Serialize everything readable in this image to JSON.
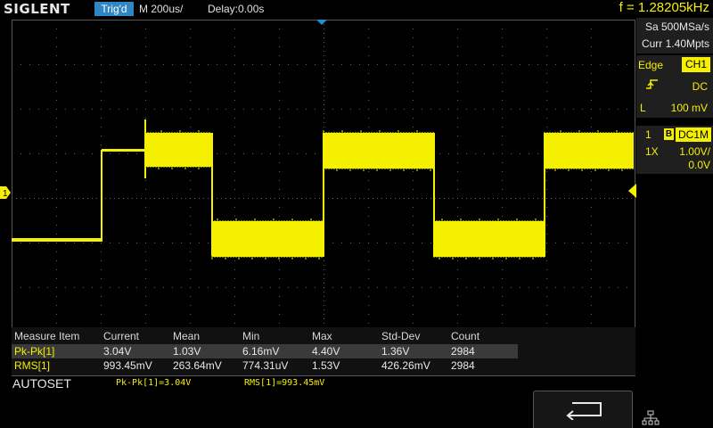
{
  "header": {
    "brand": "SIGLENT",
    "trigger_status": "Trig'd",
    "timebase": "M 200us/",
    "delay": "Delay:0.00s",
    "frequency": "f = 1.28205kHz"
  },
  "acquisition": {
    "sample_rate": "Sa 500MSa/s",
    "memory_depth": "Curr 1.40Mpts"
  },
  "trigger": {
    "type": "Edge",
    "source": "CH1",
    "slope_icon": "rising-edge-icon",
    "coupling": "DC",
    "level_label": "L",
    "level": "100 mV"
  },
  "channel": {
    "number": "1",
    "bw_limit_label": "B",
    "coupling_impedance": "DC1M",
    "probe": "1X",
    "scale": "1.00V/",
    "offset": "0.0V",
    "marker_label": "1"
  },
  "measurements": {
    "headers": [
      "Measure Item",
      "Current",
      "Mean",
      "Min",
      "Max",
      "Std-Dev",
      "Count"
    ],
    "rows": [
      [
        "Pk-Pk[1]",
        "3.04V",
        "1.03V",
        "6.16mV",
        "4.40V",
        "1.36V",
        "2984"
      ],
      [
        "RMS[1]",
        "993.45mV",
        "263.64mV",
        "774.31uV",
        "1.53V",
        "426.26mV",
        "2984"
      ]
    ]
  },
  "footer": {
    "autoset_label": "AUTOSET",
    "summary_pkpk": "Pk-Pk[1]=3.04V",
    "summary_rms": "RMS[1]=993.45mV",
    "back_icon": "return-arrow-icon",
    "network_icon": "network-icon"
  },
  "colors": {
    "trace": "#f5f000",
    "trigger_badge": "#2f86c5",
    "trigger_marker": "#1e90d0",
    "panel_bg": "#1f1f1f"
  }
}
